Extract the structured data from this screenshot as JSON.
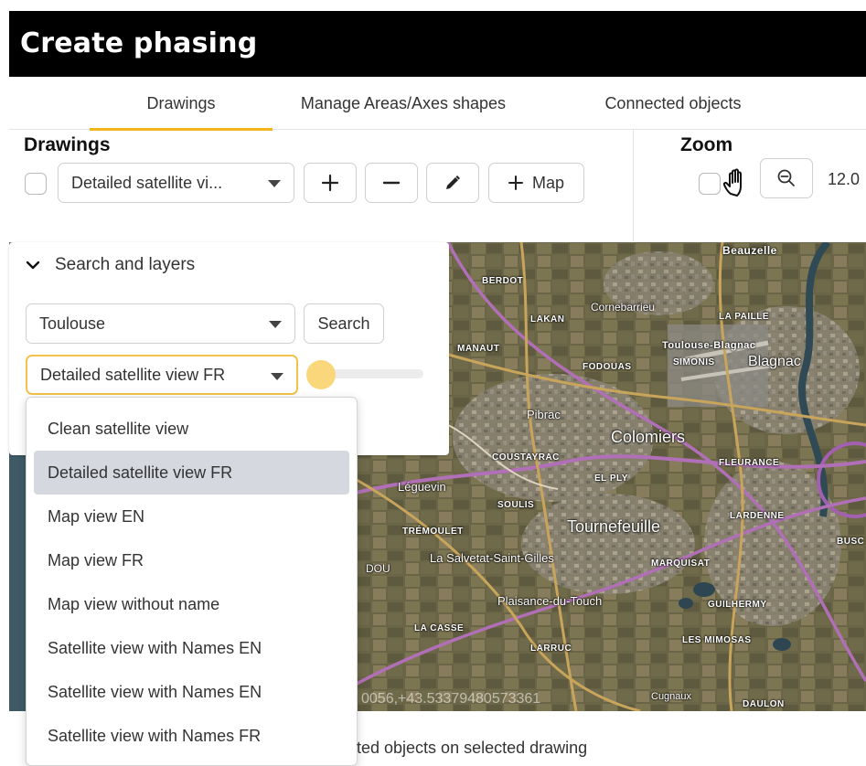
{
  "window": {
    "title": "Create phasing"
  },
  "tabs": [
    {
      "label": "Drawings",
      "active": true
    },
    {
      "label": "Manage Areas/Axes shapes",
      "active": false
    },
    {
      "label": "Connected objects",
      "active": false
    }
  ],
  "drawings": {
    "label": "Drawings",
    "select_value": "Detailed satellite vi...",
    "add_icon": "plus-icon",
    "remove_icon": "minus-icon",
    "edit_icon": "pencil-icon",
    "map_button_label": "Map"
  },
  "zoom": {
    "label": "Zoom",
    "hand_icon": "hand-icon",
    "zoom_out_icon": "zoom-out-icon",
    "value": "12.0"
  },
  "search_layers": {
    "header": "Search and layers",
    "location_value": "Toulouse",
    "search_button": "Search",
    "layer_value": "Detailed satellite view FR",
    "opacity_fraction": 0.0
  },
  "layer_options": [
    {
      "label": "Clean satellite view",
      "selected": false
    },
    {
      "label": "Detailed satellite view FR",
      "selected": true
    },
    {
      "label": "Map view EN",
      "selected": false
    },
    {
      "label": "Map view FR",
      "selected": false
    },
    {
      "label": "Map view without name",
      "selected": false
    },
    {
      "label": "Satellite view with Names EN",
      "selected": false
    },
    {
      "label": "Satellite view with Names EN",
      "selected": false
    },
    {
      "label": "Satellite view with Names FR",
      "selected": false
    }
  ],
  "map": {
    "coords_text": "0056,+43.53379480573361",
    "labels": {
      "beauzelle": "Beauzelle",
      "cornebarrieu": "Cornebarrieu",
      "toulouse_blagnac": "Toulouse-Blagnac",
      "blagnac": "Blagnac",
      "pibrac": "Pibrac",
      "colomiers": "Colomiers",
      "lequevin": "Léguevin",
      "tournefeuille": "Tournefeuille",
      "la_salvetat": "La Salvetat-Saint-Gilles",
      "plaisance": "Plaisance-du-Touch",
      "cugnaux": "Cugnaux",
      "berdot": "BERDOT",
      "lakan": "LAKAN",
      "manaut": "MANAUT",
      "fodouas": "FODOUAS",
      "la_paille": "LA PAILLE",
      "simonis": "SIMONIS",
      "coustayrac": "COUSTAYRAC",
      "fleurance": "FLEURANCE",
      "el_ply": "EL PLY",
      "soulis": "SOULIS",
      "lardenne": "LARDENNE",
      "tremoulet": "TRÉMOULET",
      "marquisat": "MARQUISAT",
      "guilhermy": "GUILHERMY",
      "la_casse": "LA CASSE",
      "larruc": "LARRUC",
      "les_mimosas": "LES MIMOSAS",
      "daulon": "DAULON",
      "busc": "BUSC",
      "dou": "DOU"
    }
  },
  "footer": {
    "status_text": "ted objects on selected drawing"
  }
}
